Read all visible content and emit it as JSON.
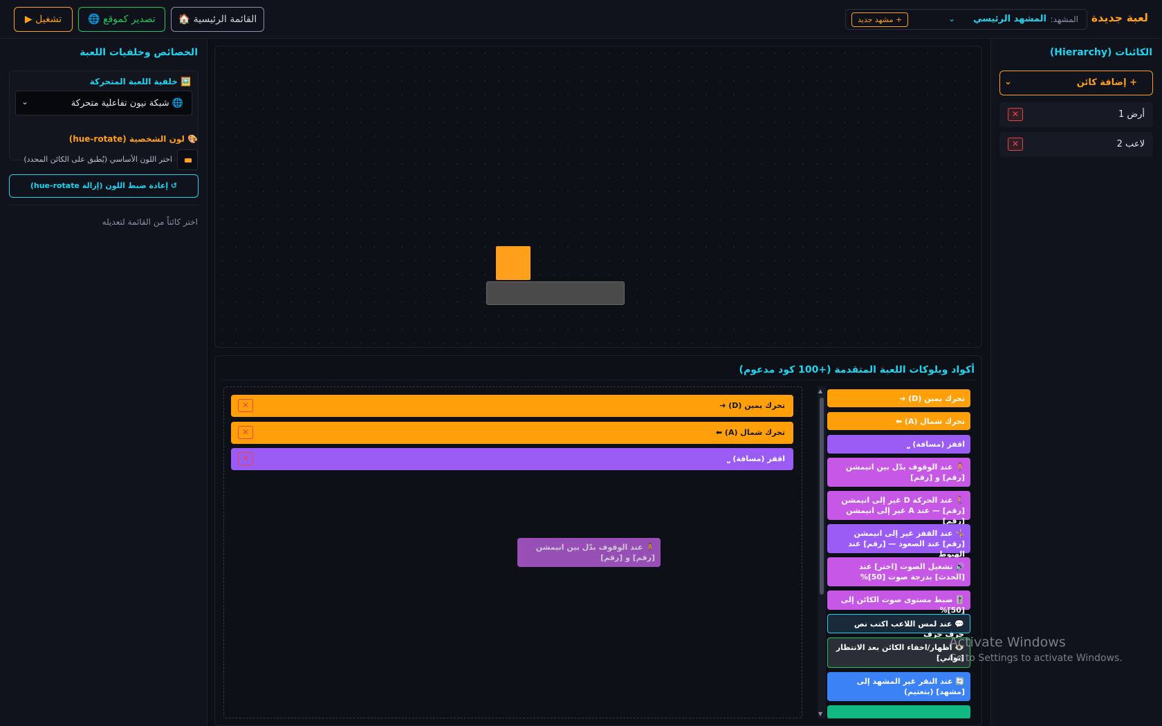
{
  "header": {
    "game_title": "لعبة جديدة",
    "scene_label": "المشهد:",
    "scene_selected": "المشهد الرئيسي",
    "new_scene_button": "+ مشهد جديد",
    "home_button": "القائمة الرئيسية 🏠",
    "export_button": "تصدير كموقع 🌐",
    "run_button": "تشغيل ▶"
  },
  "hierarchy": {
    "title": "الكائنات (Hierarchy)",
    "add_object": "+ إضافة كائن",
    "objects": [
      {
        "name": "أرض 1"
      },
      {
        "name": "لاعب 2"
      }
    ]
  },
  "properties": {
    "title": "الخصائص وخلفيات اللعبة",
    "background_card_title": "🖼️ خلفية اللعبة المتحركة",
    "background_selected": "🌐 شبكة نيون تفاعلية متحركة",
    "color_title": "🎨 لون الشخصية (hue-rotate)",
    "color_hint": "اختر اللون الأساسي (يُطبق على الكائن المحدد)",
    "reset_button": "↺ إعادة ضبط اللون (إزالة hue-rotate)",
    "select_hint": "اختر كائناً من القائمة لتعديله"
  },
  "blocks": {
    "title": "أكواد وبلوكات اللعبة المتقدمة (+100 كود مدعوم)",
    "palette": [
      {
        "label": "تحرك يمين (D) ➔",
        "color": "#ff9f0a"
      },
      {
        "label": "تحرك شمال (A) ⬅",
        "color": "#ff9f0a"
      },
      {
        "label": "اقفز (مسافة) ⎵",
        "color": "#9b5cf6"
      },
      {
        "label": "🧍 عند الوقوف بدّل بين انيمشن [رقم] و [رقم]",
        "color": "#c758e6"
      },
      {
        "label": "🚶 عند الحركة D غير إلى انيمشن [رقم] — عند A غير إلى انيمشن [رقم]",
        "color": "#c758e6"
      },
      {
        "label": "🤸 عند القفز غير إلى انيمشن [رقم] عند الصعود — [رقم] عند الهبوط",
        "color": "#9b5cf6"
      },
      {
        "label": "🔊 تشغيل الصوت [اختر] عند [الحدث] بدرجة صوت [50]%",
        "color": "#c758e6"
      },
      {
        "label": "🎚️ ضبط مستوى صوت الكائن إلى [50]%",
        "color": "#c758e6"
      },
      {
        "label": "💬 عند لمس اللاعب اكتب نص حرف حرف",
        "color": "#1b2a3a"
      },
      {
        "label": "👁️ اظهار/اخفاء الكائن بعد الانتظار [ثواني]",
        "color": "#2a2e36"
      },
      {
        "label": "🔄 عند النقر غير المشهد إلى [مشهد] (بتعتيم)",
        "color": "#3b82f6"
      },
      {
        "label": "",
        "color": "#10b981"
      }
    ],
    "workspace": [
      {
        "label": "تحرك يمين (D) ➔",
        "color": "#ff9f0a"
      },
      {
        "label": "تحرك شمال (A) ⬅",
        "color": "#ff9f0a"
      },
      {
        "label": "اقفز (مسافة) ⎵",
        "color": "#9b5cf6"
      }
    ],
    "dragging_block": "🧍 عند الوقوف بدّل بين انيمشن [رقم] و [رقم]",
    "delete_symbol": "✕"
  },
  "canvas_objects": {
    "player_color": "#ff9f1a",
    "ground_color": "#4a4a4a"
  },
  "watermark": {
    "line1": "Activate Windows",
    "line2": "Go to Settings to activate Windows."
  }
}
